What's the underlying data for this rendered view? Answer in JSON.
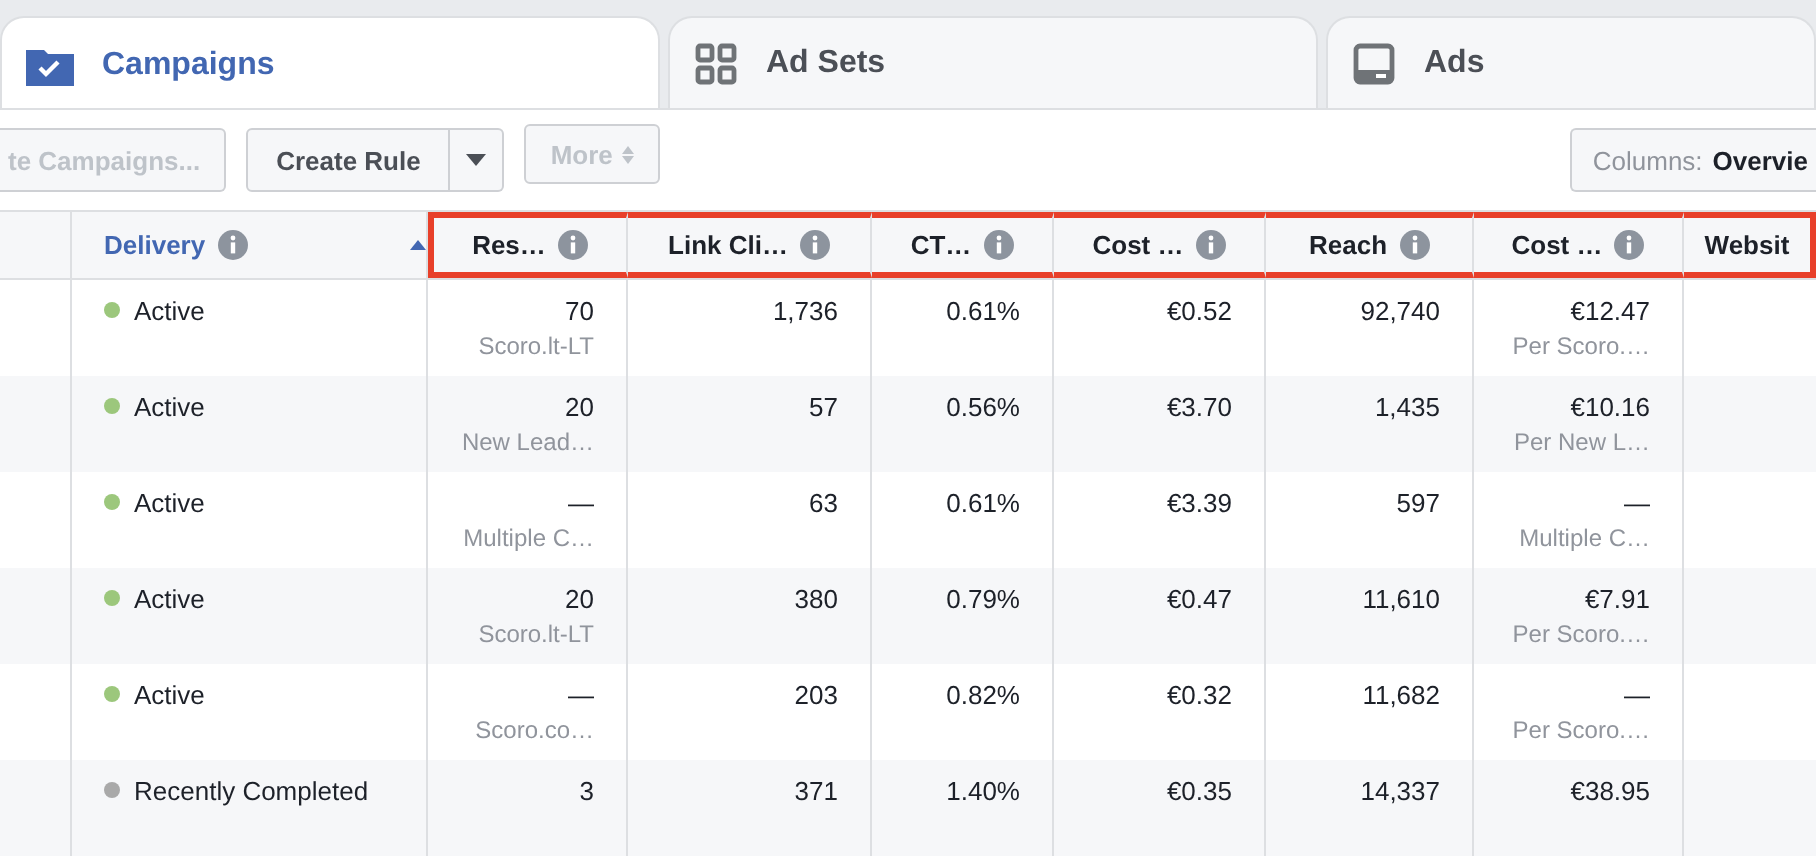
{
  "tabs": [
    {
      "label": "Campaigns",
      "selected": true
    },
    {
      "label": "Ad Sets",
      "selected": false
    },
    {
      "label": "Ads",
      "selected": false
    }
  ],
  "toolbar": {
    "buttons": [
      {
        "label": "te Campaigns...",
        "kind": "plain",
        "disabled": true
      },
      {
        "label": "Create Rule",
        "kind": "split",
        "disabled": false
      },
      {
        "label": "More",
        "kind": "updown",
        "disabled": true
      }
    ],
    "columns_button": {
      "label": "Columns:",
      "value": "Overvie"
    }
  },
  "table": {
    "columns": [
      {
        "label": "Delivery",
        "info": true,
        "sorted": true,
        "highlighted": false
      },
      {
        "label": "Res…",
        "info": true,
        "sorted": false,
        "highlighted": true
      },
      {
        "label": "Link Cli…",
        "info": true,
        "sorted": false,
        "highlighted": true
      },
      {
        "label": "CT…",
        "info": true,
        "sorted": false,
        "highlighted": true
      },
      {
        "label": "Cost …",
        "info": true,
        "sorted": false,
        "highlighted": true
      },
      {
        "label": "Reach",
        "info": true,
        "sorted": false,
        "highlighted": true
      },
      {
        "label": "Cost …",
        "info": true,
        "sorted": false,
        "highlighted": true
      },
      {
        "label": "Websit",
        "info": false,
        "sorted": false,
        "highlighted": true
      }
    ],
    "rows": [
      {
        "cells": [
          {
            "kind": "status",
            "value": "Active",
            "color": "#9cc77c"
          },
          {
            "value": "70",
            "sub": "Scoro.lt-LT"
          },
          {
            "value": "1,736"
          },
          {
            "value": "0.61%"
          },
          {
            "value": "€0.52"
          },
          {
            "value": "92,740"
          },
          {
            "value": "€12.47",
            "sub": "Per Scoro.…"
          }
        ]
      },
      {
        "cells": [
          {
            "kind": "status",
            "value": "Active",
            "color": "#9cc77c"
          },
          {
            "value": "20",
            "sub": "New Lead…"
          },
          {
            "value": "57"
          },
          {
            "value": "0.56%"
          },
          {
            "value": "€3.70"
          },
          {
            "value": "1,435"
          },
          {
            "value": "€10.16",
            "sub": "Per New L…"
          }
        ]
      },
      {
        "cells": [
          {
            "kind": "status",
            "value": "Active",
            "color": "#9cc77c"
          },
          {
            "value": "—",
            "sub": "Multiple C…"
          },
          {
            "value": "63"
          },
          {
            "value": "0.61%"
          },
          {
            "value": "€3.39"
          },
          {
            "value": "597"
          },
          {
            "value": "—",
            "sub": "Multiple C…"
          }
        ]
      },
      {
        "cells": [
          {
            "kind": "status",
            "value": "Active",
            "color": "#9cc77c"
          },
          {
            "value": "20",
            "sub": "Scoro.lt-LT"
          },
          {
            "value": "380"
          },
          {
            "value": "0.79%"
          },
          {
            "value": "€0.47"
          },
          {
            "value": "11,610"
          },
          {
            "value": "€7.91",
            "sub": "Per Scoro.…"
          }
        ]
      },
      {
        "cells": [
          {
            "kind": "status",
            "value": "Active",
            "color": "#9cc77c"
          },
          {
            "value": "—",
            "sub": "Scoro.co…"
          },
          {
            "value": "203"
          },
          {
            "value": "0.82%"
          },
          {
            "value": "€0.32"
          },
          {
            "value": "11,682"
          },
          {
            "value": "—",
            "sub": "Per Scoro.…"
          }
        ]
      },
      {
        "cells": [
          {
            "kind": "status",
            "value": "Recently Completed",
            "color": "#a9a9a9"
          },
          {
            "value": "3"
          },
          {
            "value": "371"
          },
          {
            "value": "1.40%"
          },
          {
            "value": "€0.35"
          },
          {
            "value": "14,337"
          },
          {
            "value": "€38.95"
          }
        ]
      }
    ]
  }
}
